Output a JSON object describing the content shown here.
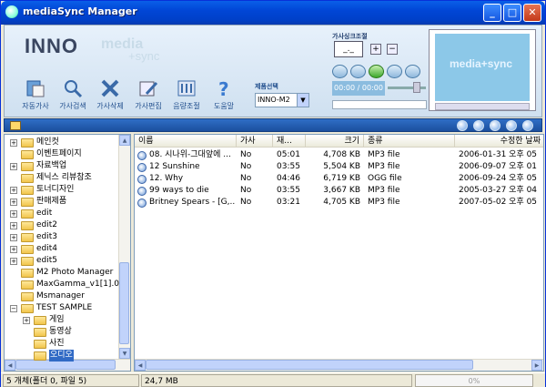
{
  "window": {
    "title": "mediaSync Manager",
    "minimize": "_",
    "maximize": "□",
    "close": "✕"
  },
  "header": {
    "logo": "INNO",
    "media_logo": "media",
    "sync_logo": "+sync",
    "tools": [
      {
        "label": "자동가사",
        "icon": "auto-lyrics-icon"
      },
      {
        "label": "가사검색",
        "icon": "lyrics-search-icon"
      },
      {
        "label": "가사삭제",
        "icon": "lyrics-delete-icon"
      },
      {
        "label": "가사편집",
        "icon": "lyrics-edit-icon"
      },
      {
        "label": "음량조절",
        "icon": "volume-adjust-icon"
      },
      {
        "label": "도움말",
        "icon": "help-icon"
      }
    ],
    "product_select": {
      "label": "제품선택",
      "value": "INNO-M2"
    },
    "lyric_sync": {
      "label": "가사싱크조절",
      "value": "_._",
      "plus": "+",
      "minus": "−"
    },
    "time_display": "00:00 / 00:00",
    "video_logo": "media+sync"
  },
  "tree": {
    "items": [
      {
        "label": "메인컷",
        "expand": "+",
        "level": 0
      },
      {
        "label": "이벤트페이지",
        "expand": "",
        "level": 0
      },
      {
        "label": "자료백업",
        "expand": "+",
        "level": 0
      },
      {
        "label": "제닉스 리뷰참조",
        "expand": "",
        "level": 0
      },
      {
        "label": "토너디자인",
        "expand": "+",
        "level": 0
      },
      {
        "label": "판매제품",
        "expand": "+",
        "level": 0
      },
      {
        "label": "edit",
        "expand": "+",
        "level": 0
      },
      {
        "label": "edit2",
        "expand": "+",
        "level": 0
      },
      {
        "label": "edit3",
        "expand": "+",
        "level": 0
      },
      {
        "label": "edit4",
        "expand": "+",
        "level": 0
      },
      {
        "label": "edit5",
        "expand": "+",
        "level": 0
      },
      {
        "label": "M2 Photo Manager",
        "expand": "",
        "level": 0
      },
      {
        "label": "MaxGamma_v1[1].0",
        "expand": "",
        "level": 0
      },
      {
        "label": "Msmanager",
        "expand": "",
        "level": 0
      },
      {
        "label": "TEST SAMPLE",
        "expand": "−",
        "level": 0
      },
      {
        "label": "게임",
        "expand": "+",
        "level": 1
      },
      {
        "label": "동영상",
        "expand": "",
        "level": 1
      },
      {
        "label": "사진",
        "expand": "",
        "level": 1
      },
      {
        "label": "오디오",
        "expand": "",
        "level": 1,
        "selected": true
      }
    ]
  },
  "files": {
    "columns": [
      "이름",
      "가사",
      "재...",
      "크기",
      "종류",
      "수정한 날짜"
    ],
    "rows": [
      {
        "name": "08. 시나위-그대앞에 ...",
        "lyrics": "No",
        "time": "05:01",
        "size": "4,708 KB",
        "type": "MP3 file",
        "date": "2006-01-31 오후 05"
      },
      {
        "name": "12 Sunshine",
        "lyrics": "No",
        "time": "03:55",
        "size": "5,504 KB",
        "type": "MP3 file",
        "date": "2006-09-07 오후 01"
      },
      {
        "name": "12. Why",
        "lyrics": "No",
        "time": "04:46",
        "size": "6,719 KB",
        "type": "OGG file",
        "date": "2006-09-24 오후 05"
      },
      {
        "name": "99 ways to die",
        "lyrics": "No",
        "time": "03:55",
        "size": "3,667 KB",
        "type": "MP3 file",
        "date": "2005-03-27 오후 04"
      },
      {
        "name": "Britney Spears - [G,...",
        "lyrics": "No",
        "time": "03:21",
        "size": "4,705 KB",
        "type": "MP3 file",
        "date": "2007-05-02 오후 05"
      }
    ]
  },
  "status": {
    "count": "5 개체(폴더 0, 파일 5)",
    "size": "24,7 MB",
    "progress": "0%"
  }
}
